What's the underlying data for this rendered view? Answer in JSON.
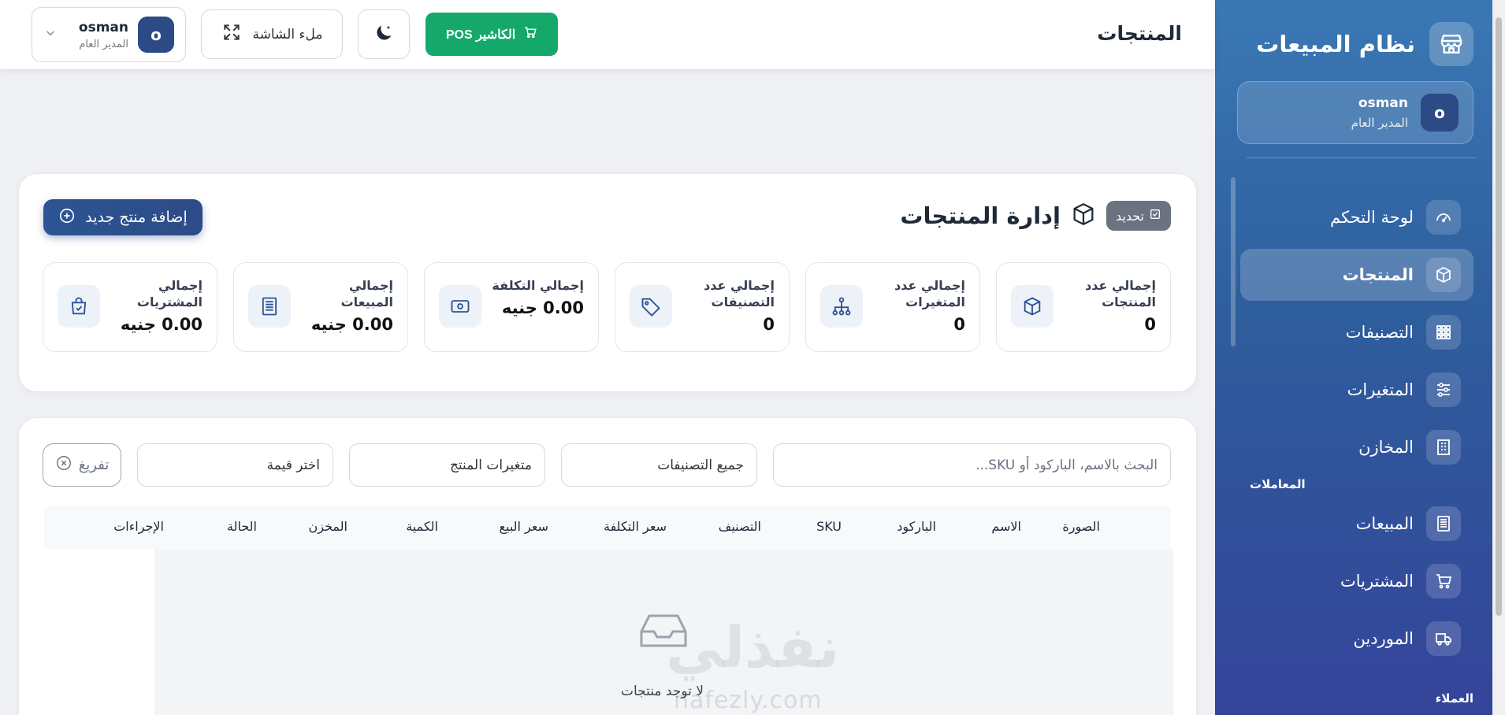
{
  "sidebar": {
    "brand_title": "نظام المبيعات",
    "user": {
      "initial": "o",
      "name": "osman",
      "role": "المدير العام"
    },
    "items": [
      {
        "label": "لوحة التحكم",
        "icon": "dashboard-icon"
      },
      {
        "label": "المنتجات",
        "icon": "box-icon",
        "active": true
      },
      {
        "label": "التصنيفات",
        "icon": "grid-icon"
      },
      {
        "label": "المتغيرات",
        "icon": "sliders-icon"
      },
      {
        "label": "المخازن",
        "icon": "building-icon"
      }
    ],
    "section_transactions": "المعاملات",
    "items2": [
      {
        "label": "المبيعات",
        "icon": "receipt-icon"
      },
      {
        "label": "المشتريات",
        "icon": "cart-icon"
      },
      {
        "label": "الموردين",
        "icon": "truck-icon"
      }
    ],
    "section_customers": "العملاء"
  },
  "topbar": {
    "page_title": "المنتجات",
    "pos_label": "الكاشير POS",
    "fullscreen_label": "ملء الشاشة",
    "user": {
      "initial": "o",
      "name": "osman",
      "role": "المدير العام"
    }
  },
  "products": {
    "refresh_label": "تحديد",
    "title": "إدارة المنتجات",
    "add_label": "إضافة منتج جديد",
    "stats": [
      {
        "label": "إجمالي عدد المنتجات",
        "value": "0",
        "icon": "box-icon"
      },
      {
        "label": "إجمالي عدد المتغيرات",
        "value": "0",
        "icon": "hierarchy-icon"
      },
      {
        "label": "إجمالي عدد التصنيفات",
        "value": "0",
        "icon": "tag-icon"
      },
      {
        "label": "إجمالي التكلفة",
        "value": "0.00 جنيه",
        "icon": "money-icon"
      },
      {
        "label": "إجمالي المبيعات",
        "value": "0.00 جنيه",
        "icon": "invoice-icon"
      },
      {
        "label": "إجمالي المشتريات",
        "value": "0.00 جنيه",
        "icon": "shopping-bag-icon"
      }
    ]
  },
  "filters": {
    "search_placeholder": "البحث بالاسم، الباركود أو SKU...",
    "category_value": "جميع التصنيفات",
    "variants_value": "متغيرات المنتج",
    "value_value": "اختر قيمة",
    "clear_label": "تفريغ"
  },
  "table": {
    "headers": [
      "الصورة",
      "الاسم",
      "الباركود",
      "SKU",
      "التصنيف",
      "سعر التكلفة",
      "سعر البيع",
      "الكمية",
      "المخزن",
      "الحالة",
      "الإجراءات"
    ],
    "empty_text": "لا توجد منتجات"
  },
  "watermark": {
    "arabic": "نفذلي",
    "latin": "nafezly.com"
  },
  "colors": {
    "sidebar_top": "#3a78b4",
    "sidebar_bottom": "#34449a",
    "pos_green": "#14a86a",
    "add_button": "#2c5593"
  }
}
